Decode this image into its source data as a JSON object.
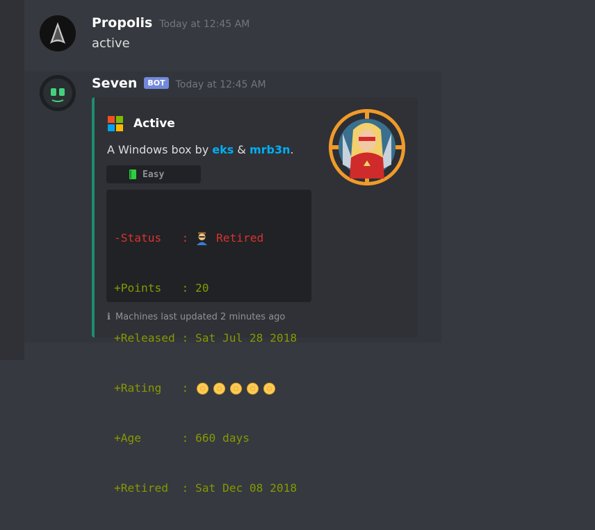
{
  "messages": [
    {
      "username": "Propolis",
      "timestamp": "Today at 12:45 AM",
      "content": "active",
      "avatar_icon": "starfleet-delta-icon"
    },
    {
      "username": "Seven",
      "bot_tag": "BOT",
      "timestamp": "Today at 12:45 AM",
      "avatar_icon": "robot-face-icon",
      "embed": {
        "accent_color": "#1f8b72",
        "author_icon": "windows-logo-icon",
        "author_name": "Active",
        "description": {
          "prefix": "A Windows box by ",
          "mention1": "eks",
          "separator": " & ",
          "mention2": "mrb3n",
          "suffix": "."
        },
        "difficulty": {
          "icon": "green-book-icon",
          "label": "Easy"
        },
        "thumbnail_icon": "hero-woman-badge-icon",
        "stats": [
          {
            "sign": "-",
            "key": "Status  ",
            "sep": " : ",
            "icon": "retired-person-icon",
            "value": "Retired",
            "color": "#dc322f"
          },
          {
            "sign": "+",
            "key": "Points  ",
            "sep": " : ",
            "value": "20",
            "color": "#859900"
          },
          {
            "sign": "+",
            "key": "Released",
            "sep": " : ",
            "value": "Sat Jul 28 2018",
            "color": "#859900"
          },
          {
            "sign": "+",
            "key": "Rating  ",
            "sep": " : ",
            "rating_coins": 5,
            "color": "#859900"
          },
          {
            "sign": "+",
            "key": "Age     ",
            "sep": " : ",
            "value": "660 days",
            "color": "#859900"
          },
          {
            "sign": "+",
            "key": "Retired ",
            "sep": " : ",
            "value": "Sat Dec 08 2018",
            "color": "#859900"
          }
        ],
        "footer_icon": "info-icon",
        "footer_text": "Machines last updated 2 minutes ago"
      }
    }
  ]
}
